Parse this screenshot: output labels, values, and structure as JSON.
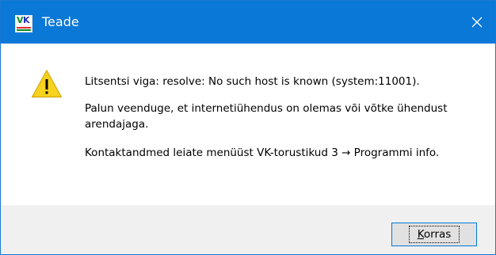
{
  "window": {
    "title": "Teade"
  },
  "app_icon": {
    "letters_v": "V",
    "letters_k": "K"
  },
  "message": {
    "line1": "Litsentsi viga: resolve: No such host is known (system:11001).",
    "line2": "Palun veenduge, et internetiühendus on olemas või võtke ühendust arendajaga.",
    "line3": "Kontaktandmed leiate menüüst VK-torustikud 3 → Programmi info."
  },
  "buttons": {
    "ok_mnemonic": "K",
    "ok_rest": "orras"
  },
  "icons": {
    "app": "vk-app-icon",
    "close": "close-icon",
    "warning": "warning-icon"
  },
  "colors": {
    "titlebar": "#0a78d7",
    "warning_fill": "#f7d21e",
    "button_border": "#0078d7"
  }
}
